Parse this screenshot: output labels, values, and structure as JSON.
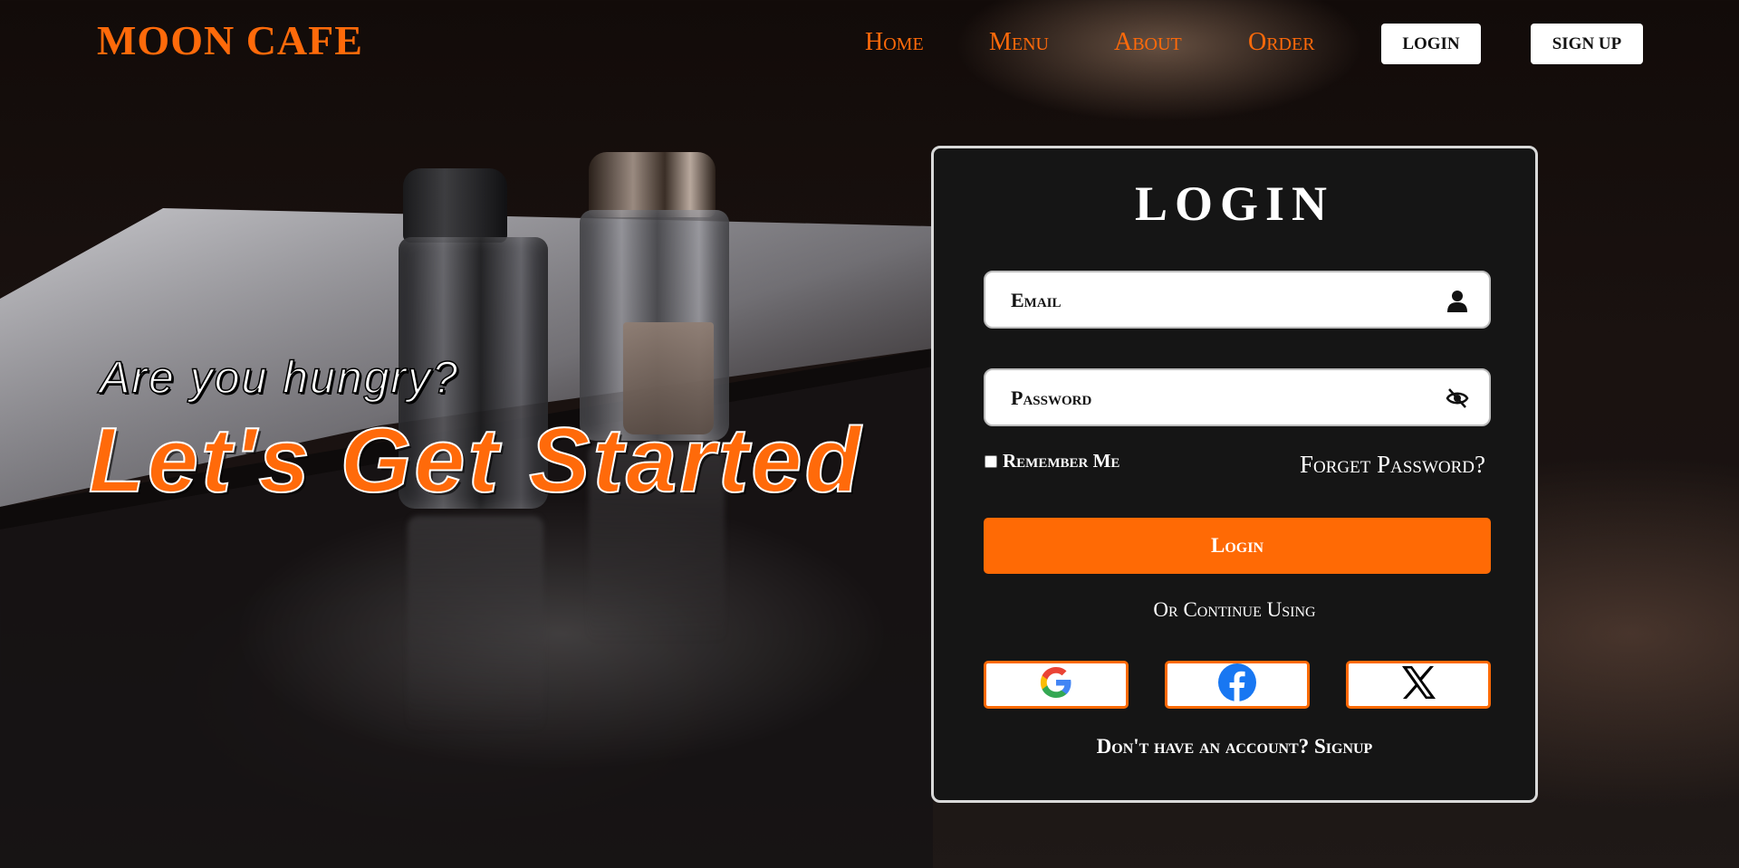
{
  "nav": {
    "brand": "MOON CAFE",
    "links": [
      {
        "label": "Home"
      },
      {
        "label": "Menu"
      },
      {
        "label": "About"
      },
      {
        "label": "Order"
      }
    ],
    "login_label": "LOGIN",
    "signup_label": "SIGN UP"
  },
  "hero": {
    "subtitle": "Are you hungry?",
    "title": "Let's Get Started"
  },
  "login": {
    "title": "LOGIN",
    "email_placeholder": "Email",
    "email_icon": "user-icon",
    "password_placeholder": "Password",
    "password_icon": "eye-slash-icon",
    "remember_label": "Remember Me",
    "remember_checked": false,
    "forget_label": "Forget Password?",
    "button_label": "Login",
    "or_text": "Or Continue Using",
    "socials": [
      {
        "icon": "google-icon"
      },
      {
        "icon": "facebook-icon"
      },
      {
        "icon": "x-icon"
      }
    ],
    "signup_prompt": "Don't have an account?",
    "signup_link": "Signup"
  },
  "colors": {
    "accent": "#ff6a05",
    "card_bg": "#151515",
    "card_border": "#d9d9d9"
  }
}
